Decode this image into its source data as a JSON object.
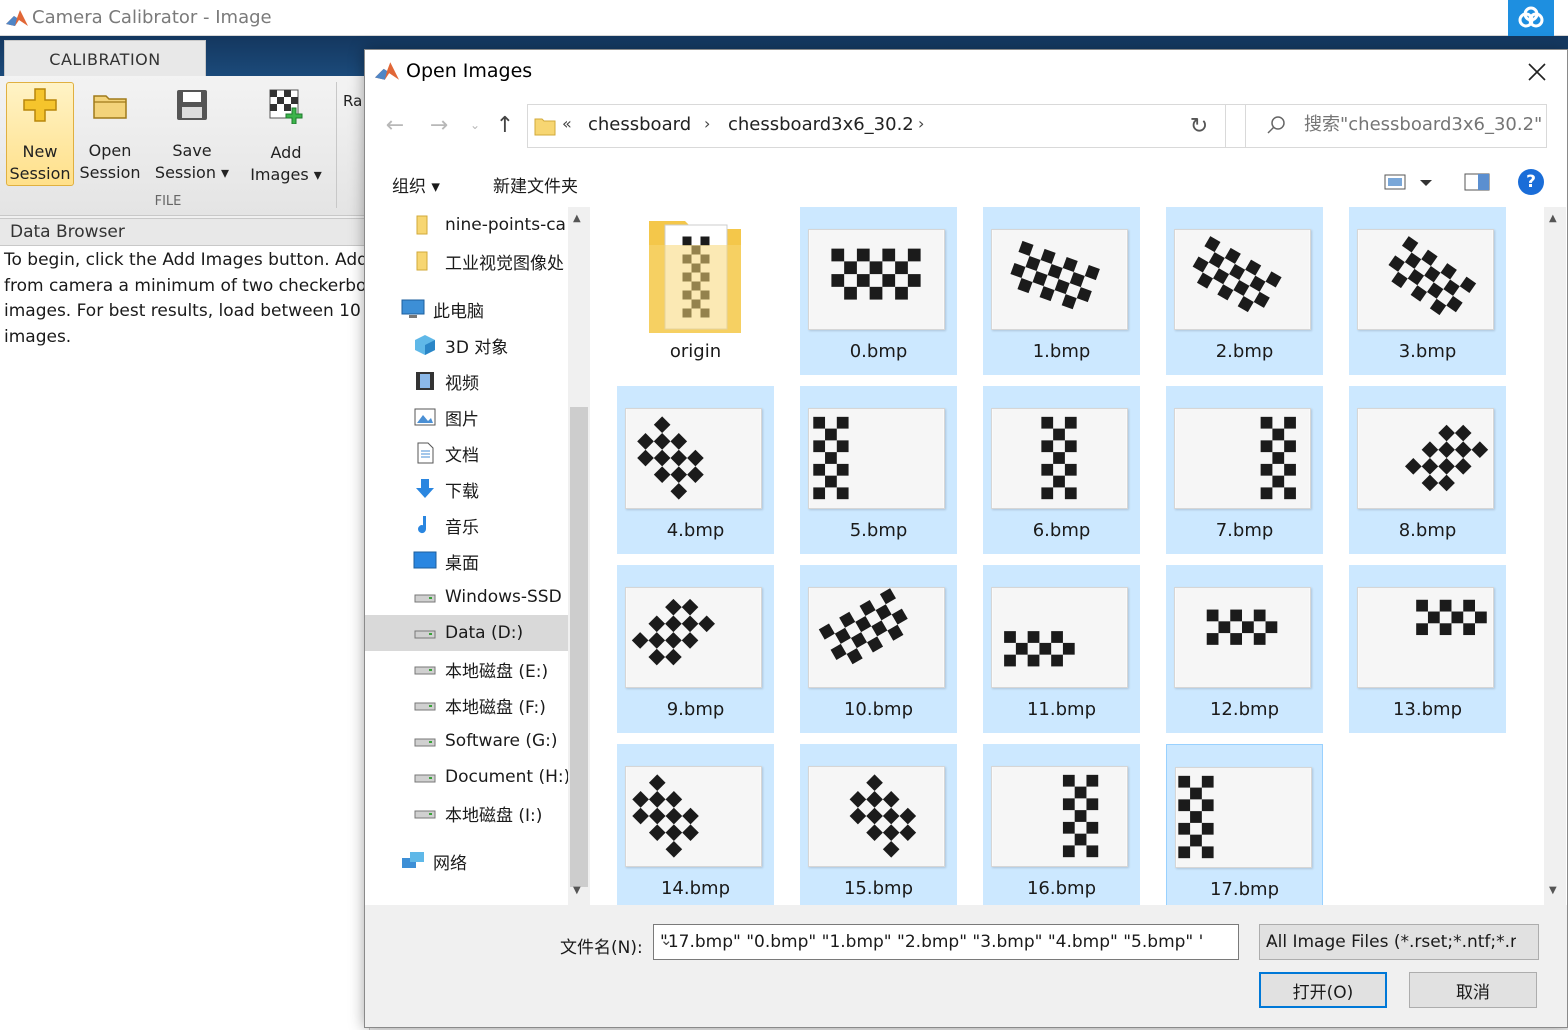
{
  "app": {
    "title": "Camera Calibrator - Image",
    "tab": "CALIBRATION",
    "ribbon": {
      "new_session_1": "New",
      "new_session_2": "Session",
      "open_session_1": "Open",
      "open_session_2": "Session",
      "save_session_1": "Save",
      "save_session_2": "Session",
      "add_images_1": "Add",
      "add_images_2": "Images",
      "section_label": "FILE",
      "truncated_label": "Ra"
    },
    "data_browser": {
      "header": "Data Browser",
      "text": "To begin, click the Add Images button. Add or acquire from camera a minimum of two checkerboard images. For best results, load between 10 and 20 images."
    }
  },
  "dialog": {
    "title": "Open Images",
    "breadcrumb": [
      "chessboard",
      "chessboard3x6_30.2"
    ],
    "search_placeholder": "搜索\"chessboard3x6_30.2\"",
    "toolbar": {
      "organize": "组织 ▾",
      "new_folder": "新建文件夹"
    },
    "nav_items": [
      {
        "label": "nine-points-ca",
        "icon": "folder-icon"
      },
      {
        "label": "工业视觉图像处",
        "icon": "folder-icon"
      },
      {
        "label": "此电脑",
        "icon": "computer-icon"
      },
      {
        "label": "3D 对象",
        "icon": "3d-objects-icon"
      },
      {
        "label": "视频",
        "icon": "video-icon"
      },
      {
        "label": "图片",
        "icon": "pictures-icon"
      },
      {
        "label": "文档",
        "icon": "documents-icon"
      },
      {
        "label": "下载",
        "icon": "download-icon"
      },
      {
        "label": "音乐",
        "icon": "music-icon"
      },
      {
        "label": "桌面",
        "icon": "desktop-icon"
      },
      {
        "label": "Windows-SSD",
        "icon": "drive-icon"
      },
      {
        "label": "Data (D:)",
        "icon": "drive-icon"
      },
      {
        "label": "本地磁盘 (E:)",
        "icon": "drive-icon"
      },
      {
        "label": "本地磁盘 (F:)",
        "icon": "drive-icon"
      },
      {
        "label": "Software (G:)",
        "icon": "drive-icon"
      },
      {
        "label": "Document (H:)",
        "icon": "drive-icon"
      },
      {
        "label": "本地磁盘 (I:)",
        "icon": "drive-icon"
      },
      {
        "label": "网络",
        "icon": "network-icon"
      }
    ],
    "files": [
      {
        "name": "origin",
        "type": "folder"
      },
      {
        "name": "0.bmp"
      },
      {
        "name": "1.bmp"
      },
      {
        "name": "2.bmp"
      },
      {
        "name": "3.bmp"
      },
      {
        "name": "4.bmp"
      },
      {
        "name": "5.bmp"
      },
      {
        "name": "6.bmp"
      },
      {
        "name": "7.bmp"
      },
      {
        "name": "8.bmp"
      },
      {
        "name": "9.bmp"
      },
      {
        "name": "10.bmp"
      },
      {
        "name": "11.bmp"
      },
      {
        "name": "12.bmp"
      },
      {
        "name": "13.bmp"
      },
      {
        "name": "14.bmp"
      },
      {
        "name": "15.bmp"
      },
      {
        "name": "16.bmp"
      },
      {
        "name": "17.bmp"
      }
    ],
    "filename_label": "文件名(N):",
    "filename_value": "\"17.bmp\" \"0.bmp\" \"1.bmp\" \"2.bmp\" \"3.bmp\" \"4.bmp\" \"5.bmp\" '",
    "filter_value": "All Image Files (*.rset;*.ntf;*.r",
    "open_button": "打开(O)",
    "cancel_button": "取消"
  },
  "colors": {
    "selection": "#cce8ff",
    "accent": "#0078d7",
    "ribbon": "#1b4a7a"
  }
}
